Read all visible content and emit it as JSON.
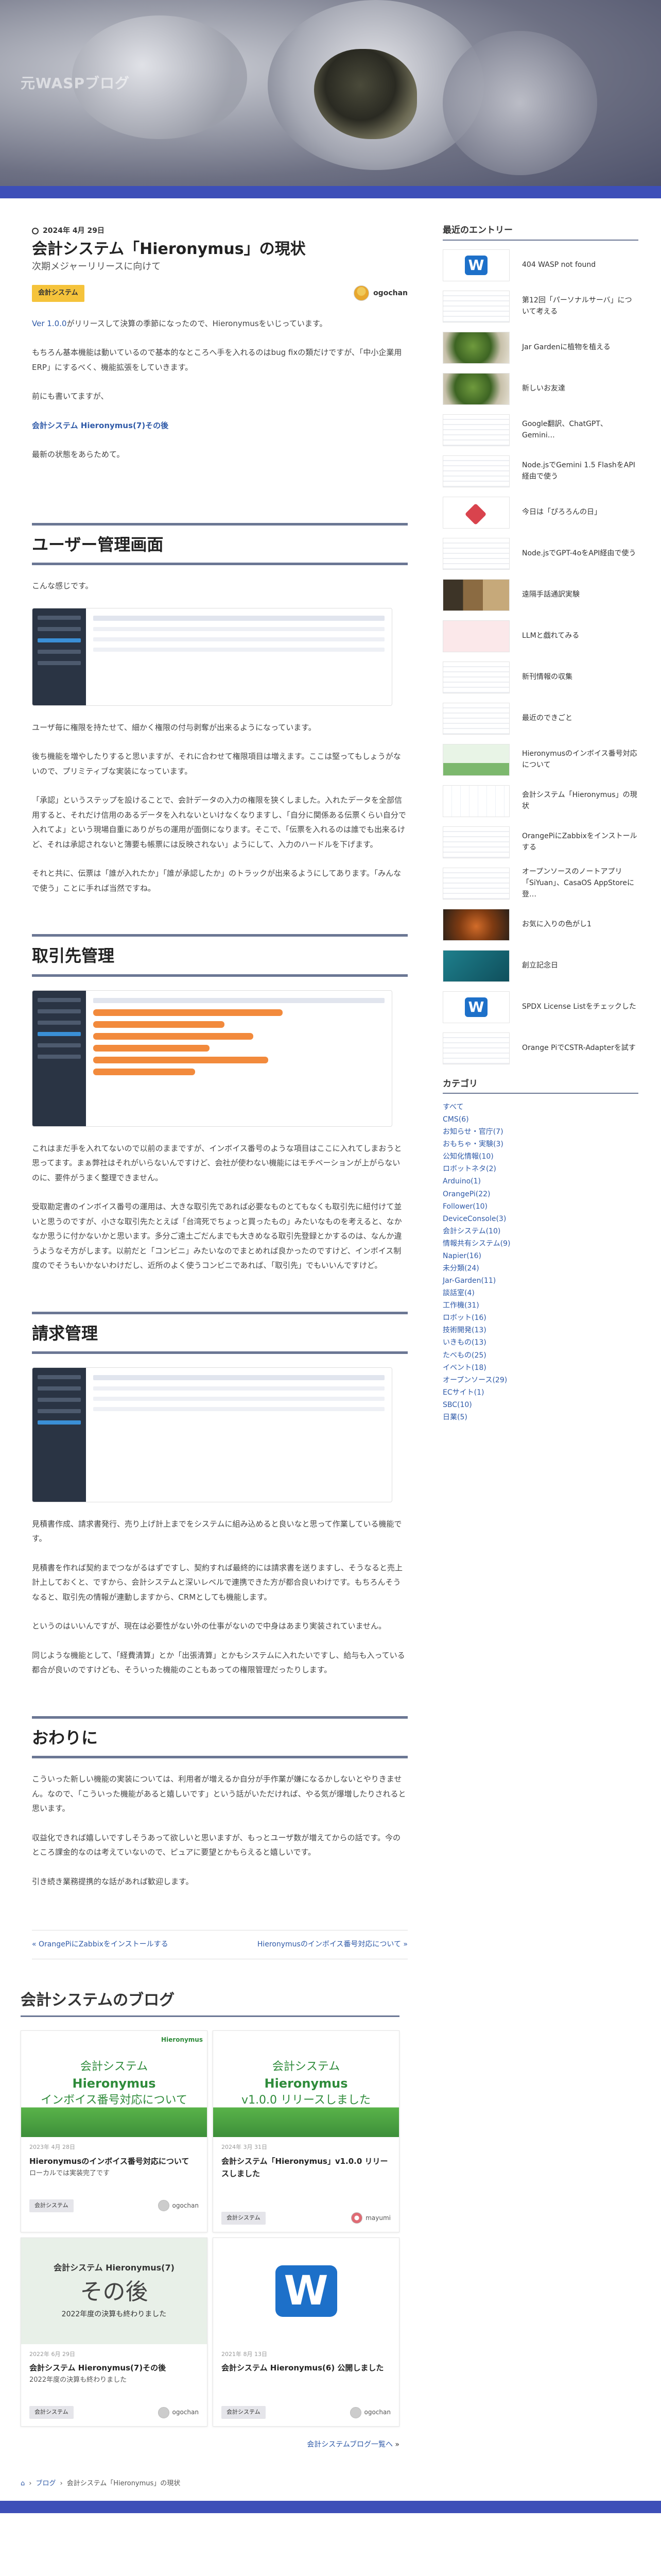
{
  "site": {
    "title": "元WASPブログ"
  },
  "post": {
    "date": "2024年 4月 29日",
    "title": "会計システム「Hieronymus」の現状",
    "subtitle": "次期メジャーリリースに向けて",
    "category": "会計システム",
    "author": "ogochan",
    "intro": [
      {
        "link": "Ver 1.0.0",
        "text": "がリリースして決算の季節になったので、Hieronymusをいじっています。"
      },
      {
        "text": "もちろん基本機能は動いているので基本的なところへ手を入れるのはbug fixの類だけですが、「中小企業用ERP」にするべく、機能拡張をしていきます。"
      },
      {
        "text": "前にも書いてますが、"
      },
      {
        "link": "会計システム Hieronymus(7)その後",
        "text": ""
      },
      {
        "text": "最新の状態をあらためて。"
      }
    ],
    "sections": [
      {
        "heading": "ユーザー管理画面",
        "paras_before": [
          "こんな感じです。"
        ],
        "paras_after": [
          "ユーザ毎に権限を持たせて、細かく権限の付与剥奪が出来るようになっています。",
          "後ち機能を増やしたりすると思いますが、それに合わせて権限項目は増えます。ここは堅ってもしょうがないので、プリミティブな実装になっています。",
          "「承認」というステップを設けることで、会計データの入力の権限を狭くしました。入れたデータを全部信用すると、それだけ信用のあるデータを入れないといけなくなりますし、「自分に関係ある伝票くらい自分で入れてよ」という現場自重にありがちの運用が面倒になります。そこで、「伝票を入れるのは誰でも出来るけど、それは承認されないと簿要も帳票には反映されない」ようにして、入力のハードルを下げます。",
          "それと共に、伝票は「誰が入れたか」「誰が承認したか」のトラックが出来るようにしてあります。「みんなで使う」ことに手れば当然ですね。"
        ]
      },
      {
        "heading": "取引先管理",
        "paras_before": [],
        "paras_after": [
          "これはまだ手を入れてないので以前のままですが、インボイス番号のような項目はここに入れてしまおうと思ってます。まぁ弊社はそれがいらないんですけど、会社が使わない機能にはモチベーションが上がらないのに、要件がうまく整理できません。",
          "受取勘定書のインボイス番号の運用は、大きな取引先であれば必要なものとてもなくも取引先に紐付けて並いと思うのですが、小さな取引先たとえば「台湾死でちょっと買ったもの」みたいなものを考えると、なかなか思うに付かないかと思います。多分ご遠土ごだんまでも大きめなる取引先登録とかするのは、なんか違うようなそ方がします。以前だと「コンビニ」みたいなのでまとめれば良かったのですけど、インボイス制度のでそうもいかないわけだし、近所のよく使うコンビニであれば、「取引先」でもいいんですけど。"
        ]
      },
      {
        "heading": "請求管理",
        "paras_before": [],
        "paras_after": [
          "見積書作成、請求書発行、売り上げ計上までをシステムに組み込めると良いなと思って作業している機能です。",
          "見積書を作れば契約までつながるはずですし、契約すれば最終的には請求書を送りますし、そうなると売上計上しておくと、ですから、会計システムと深いレベルで連携できた方が都合良いわけです。もちろんそうなると、取引先の情報が連動しますから、CRMとしても機能します。",
          "というのはいいんですが、現在は必要性がない外の仕事がないので中身はあまり実装されていません。",
          "同じような機能として、「経費清算」とか「出張清算」とかもシステムに入れたいですし、給与も入っている都合が良いのですけども、そういった機能のこともあっての権限管理だったりします。"
        ]
      },
      {
        "heading": "おわりに",
        "paras_before": [
          "こういった新しい機能の実装については、利用者が増えるか自分が手作業が嫌になるかしないとやりきません。なので、「こういった機能があると嬉しいです」という話がいただければ、やる気が爆増したりされると思います。",
          "収益化できれば嬉しいですしそうあって欲しいと思いますが、もっとユーザ数が増えてからの話です。今のところ課金的なのは考えていないので、ピュアに要望とかもらえると嬉しいです。",
          "引き続き業務提携的な話があれば歓迎します。"
        ],
        "paras_after": []
      }
    ],
    "nav": {
      "prev": "OrangePiにZabbixをインストールする",
      "next": "Hieronymusのインボイス番号対応について"
    }
  },
  "related": {
    "heading": "会計システムのブログ",
    "cards": [
      {
        "thumb_brand": "Hieronymus",
        "thumb_l1": "会計システム",
        "thumb_l2": "Hieronymus",
        "thumb_l3": "インボイス番号対応について",
        "date": "2023年 4月 28日",
        "title": "Hieronymusのインボイス番号対応について",
        "excerpt": "ローカルでは実装完了です",
        "category": "会計システム",
        "author": "ogochan"
      },
      {
        "thumb_brand": "",
        "thumb_l1": "会計システム",
        "thumb_l2": "Hieronymus",
        "thumb_l3": "v1.0.0 リリースしました",
        "date": "2024年 3月 31日",
        "title": "会計システム「Hieronymus」v1.0.0 リリースしました",
        "excerpt": "",
        "category": "会計システム",
        "author": "mayumi"
      },
      {
        "thumb_l1": "会計システム Hieronymus(7)",
        "thumb_l2": "その後",
        "thumb_l3": "2022年度の決算も終わりました",
        "date": "2022年 6月 29日",
        "title": "会計システム Hieronymus(7)その後",
        "excerpt": "2022年度の決算も終わりました",
        "category": "会計システム",
        "author": "ogochan"
      },
      {
        "thumb_logo": "W",
        "date": "2021年 8月 13日",
        "title": "会計システム Hieronymus(6) 公開しました",
        "excerpt": "",
        "category": "会計システム",
        "author": "ogochan"
      }
    ],
    "more": "会計システムブログ一覧へ"
  },
  "breadcrumb": [
    "ブログ",
    "会計システム「Hieronymus」の現状"
  ],
  "sidebar": {
    "recent_title": "最近のエントリー",
    "recent": [
      {
        "title": "404 WASP not found",
        "thumb": "w"
      },
      {
        "title": "第12回「パーソナルサーバ」について考える",
        "thumb": "doc"
      },
      {
        "title": "Jar Gardenに植物を植える",
        "thumb": "plant"
      },
      {
        "title": "新しいお友達",
        "thumb": "plant"
      },
      {
        "title": "Google翻訳、ChatGPT、Gemini…",
        "thumb": "doc"
      },
      {
        "title": "Node.jsでGemini 1.5 FlashをAPI経由で使う",
        "thumb": "doc"
      },
      {
        "title": "今日は「ぴろろんの日」",
        "thumb": "red"
      },
      {
        "title": "Node.jsでGPT-4oをAPI経由で使う",
        "thumb": "doc"
      },
      {
        "title": "遠隔手話通訳実験",
        "thumb": "book"
      },
      {
        "title": "LLMと戯れてみる",
        "thumb": "pink"
      },
      {
        "title": "新刊情報の収集",
        "thumb": "doc"
      },
      {
        "title": "最近のできごと",
        "thumb": "doc"
      },
      {
        "title": "Hieronymusのインボイス番号対応について",
        "thumb": "green"
      },
      {
        "title": "会計システム「Hieronymus」の現状",
        "thumb": "chart"
      },
      {
        "title": "OrangePiにZabbixをインストールする",
        "thumb": "doc"
      },
      {
        "title": "オープンソースのノートアプリ「SiYuan」、CasaOS AppStoreに登…",
        "thumb": "doc"
      },
      {
        "title": "お気に入りの色がし1",
        "thumb": "orange"
      },
      {
        "title": "創立記念日",
        "thumb": "teal"
      },
      {
        "title": "SPDX License Listをチェックした",
        "thumb": "w"
      },
      {
        "title": "Orange PiでCSTR-Adapterを試す",
        "thumb": "doc"
      }
    ],
    "cat_title": "カテゴリ",
    "categories": [
      "すべて",
      "CMS(6)",
      "お知らせ・官庁(7)",
      "おもちゃ・実験(3)",
      "公知化情報(10)",
      "ロボットネタ(2)",
      "Arduino(1)",
      "OrangePi(22)",
      "Follower(10)",
      "DeviceConsole(3)",
      "会計システム(10)",
      "情報共有システム(9)",
      "Napier(16)",
      "未分類(24)",
      "Jar-Garden(11)",
      "談話室(4)",
      "工作機(31)",
      "ロボット(16)",
      "技術開発(13)",
      "いきもの(13)",
      "たべもの(25)",
      "イベント(18)",
      "オープンソース(29)",
      "ECサイト(1)",
      "SBC(10)",
      "日業(5)"
    ]
  },
  "colors": {
    "accent": "#3d4fb8",
    "link": "#2f5aa8",
    "badge": "#f5c33b",
    "heading_rule": "#6b7794"
  }
}
